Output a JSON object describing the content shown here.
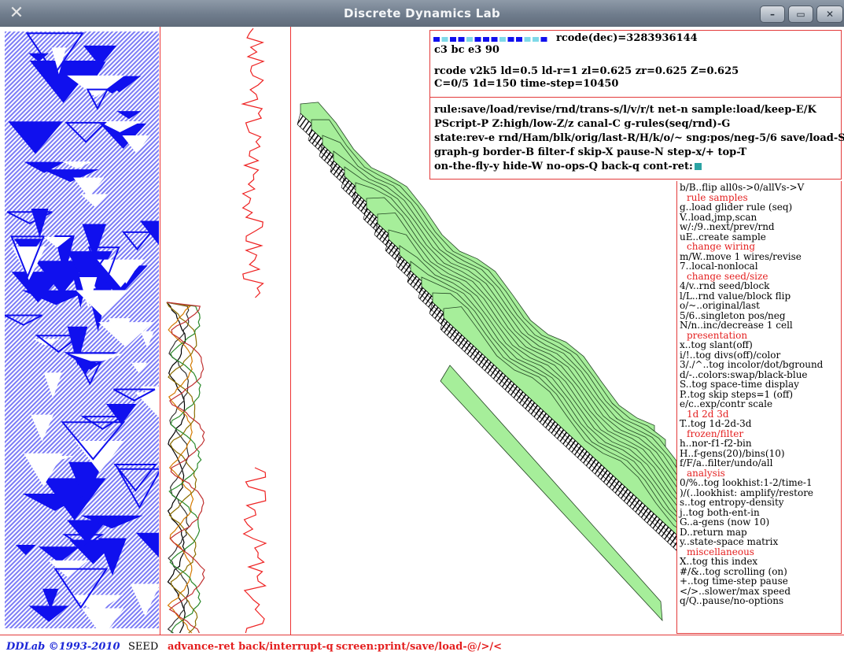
{
  "window": {
    "title": "Discrete Dynamics Lab",
    "app_icon": "x-logo-icon",
    "buttons": {
      "minimize": "minimize-icon",
      "maximize": "maximize-icon",
      "close": "close-icon"
    }
  },
  "colors": {
    "ca_blue": "#1010ee",
    "accent_red": "#e33a3a",
    "basin_green": "#a6ee9a",
    "cont_ret": "#2ba3a3"
  },
  "info": {
    "rcode_dec": "rcode(dec)=3283936144",
    "rcode_hex": "c3  bc  e3  90",
    "rcode_params": "rcode v2k5 ld=0.5 ld-r=1 zl=0.625 zr=0.625 Z=0.625",
    "rcode_state": "C=0/5  1d=150  time-step=10450",
    "rule_lines": [
      "rule:save/load/revise/rnd/trans-s/l/v/r/t net-n sample:load/keep-E/K",
      "PScript-P Z:high/low-Z/z canal-C g-rules(seq/rnd)-G",
      "state:rev-e rnd/Ham/blk/orig/last-R/H/k/o/~ sng:pos/neg-5/6 save/load-S/L",
      "graph-g border-B filter-f skip-X pause-N step-x/+ top-T"
    ],
    "last_line": "on-the-fly-y hide-W no-ops-Q back-q cont-ret:"
  },
  "options": [
    {
      "text": "b/B..flip all0s->0/allVs->V",
      "head": false
    },
    {
      "text": "rule samples",
      "head": true
    },
    {
      "text": "g..load glider rule (seq)",
      "head": false
    },
    {
      "text": "V..load,jmp,scan",
      "head": false
    },
    {
      "text": "w/:/9..next/prev/rnd",
      "head": false
    },
    {
      "text": "uE..create sample",
      "head": false
    },
    {
      "text": "change wiring",
      "head": true
    },
    {
      "text": "m/W..move 1 wires/revise",
      "head": false
    },
    {
      "text": "7..local-nonlocal",
      "head": false
    },
    {
      "text": "change seed/size",
      "head": true
    },
    {
      "text": "4/v..rnd seed/block",
      "head": false
    },
    {
      "text": "l/L..rnd value/block flip",
      "head": false
    },
    {
      "text": "o/~..original/last",
      "head": false
    },
    {
      "text": "5/6..singleton pos/neg",
      "head": false
    },
    {
      "text": "N/n..inc/decrease 1 cell",
      "head": false
    },
    {
      "text": "presentation",
      "head": true
    },
    {
      "text": "x..tog slant(off)",
      "head": false
    },
    {
      "text": "i/!..tog divs(off)/color",
      "head": false
    },
    {
      "text": "3/./^..tog incolor/dot/bground",
      "head": false
    },
    {
      "text": "d/-..colors:swap/black-blue",
      "head": false
    },
    {
      "text": "S..tog space-time display",
      "head": false
    },
    {
      "text": "P..tog skip steps=1 (off)",
      "head": false
    },
    {
      "text": "e/c..exp/contr scale",
      "head": false
    },
    {
      "text": "1d 2d 3d",
      "head": true
    },
    {
      "text": "T..tog 1d-2d-3d",
      "head": false
    },
    {
      "text": "frozen/filter",
      "head": true
    },
    {
      "text": "h..nor-f1-f2-bin",
      "head": false
    },
    {
      "text": "H..f-gens(20)/bins(10)",
      "head": false
    },
    {
      "text": "f/F/a..filter/undo/all",
      "head": false
    },
    {
      "text": "analysis",
      "head": true
    },
    {
      "text": "0/%..tog lookhist:1-2/time-1",
      "head": false
    },
    {
      "text": ")/(..lookhist: amplify/restore",
      "head": false
    },
    {
      "text": "s..tog entropy-density",
      "head": false
    },
    {
      "text": "j..tog both-ent-in",
      "head": false
    },
    {
      "text": "G..a-gens (now 10)",
      "head": false
    },
    {
      "text": "D..return map",
      "head": false
    },
    {
      "text": "y..state-space matrix",
      "head": false
    },
    {
      "text": "miscellaneous",
      "head": true
    },
    {
      "text": "X..tog this index",
      "head": false
    },
    {
      "text": "#/&..tog scrolling (on)",
      "head": false
    },
    {
      "text": "+..tog time-step pause",
      "head": false
    },
    {
      "text": "</>..slower/max speed",
      "head": false
    },
    {
      "text": "q/Q..pause/no-options",
      "head": false
    }
  ],
  "status": {
    "brand": "DDLab ©1993-2010",
    "seed": "SEED",
    "advance": "advance-ret back/interrupt-q",
    "screen": "screen:print/save/load-@/>/<"
  }
}
